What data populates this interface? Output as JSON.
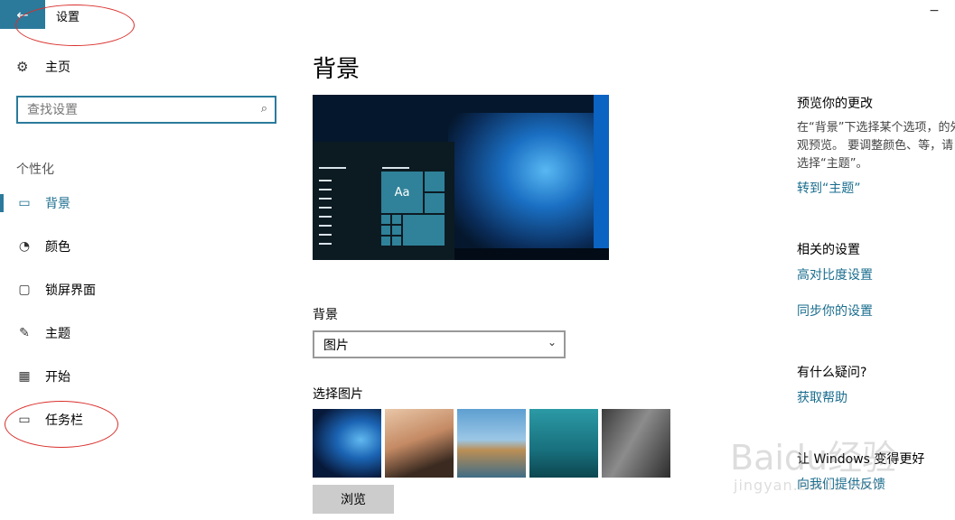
{
  "window": {
    "title": "设置",
    "back_icon": "←",
    "minimize_icon": "−"
  },
  "sidebar": {
    "home": {
      "icon": "⚙",
      "label": "主页"
    },
    "search": {
      "placeholder": "查找设置",
      "icon": "⌕"
    },
    "section": "个性化",
    "items": [
      {
        "icon": "▭",
        "label": "背景",
        "active": true
      },
      {
        "icon": "◔",
        "label": "颜色"
      },
      {
        "icon": "▢",
        "label": "锁屏界面"
      },
      {
        "icon": "✎",
        "label": "主题"
      },
      {
        "icon": "▦",
        "label": "开始"
      },
      {
        "icon": "▭",
        "label": "任务栏"
      }
    ]
  },
  "main": {
    "title": "背景",
    "preview": {
      "tile_text": "Aa"
    },
    "background_label": "背景",
    "background_value": "图片",
    "chevron_icon": "⌄",
    "choose_label": "选择图片",
    "browse_label": "浏览"
  },
  "right": {
    "preview_heading": "预览你的更改",
    "preview_text": "在“背景”下选择某个选项，的外观预览。 要调整颜色、等，请选择“主题”。",
    "theme_link": "转到“主题”",
    "related_heading": "相关的设置",
    "high_contrast_link": "高对比度设置",
    "sync_link": "同步你的设置",
    "question_heading": "有什么疑问?",
    "help_link": "获取帮助",
    "improve_heading": "让 Windows 变得更好",
    "feedback_link": "向我们提供反馈"
  },
  "watermark": {
    "text": "Baidu经验",
    "url": "jingyan.baidu.com"
  },
  "colors": {
    "accent": "#2b7a9b",
    "link": "#1a6d8e",
    "annotation": "#d9302c"
  }
}
